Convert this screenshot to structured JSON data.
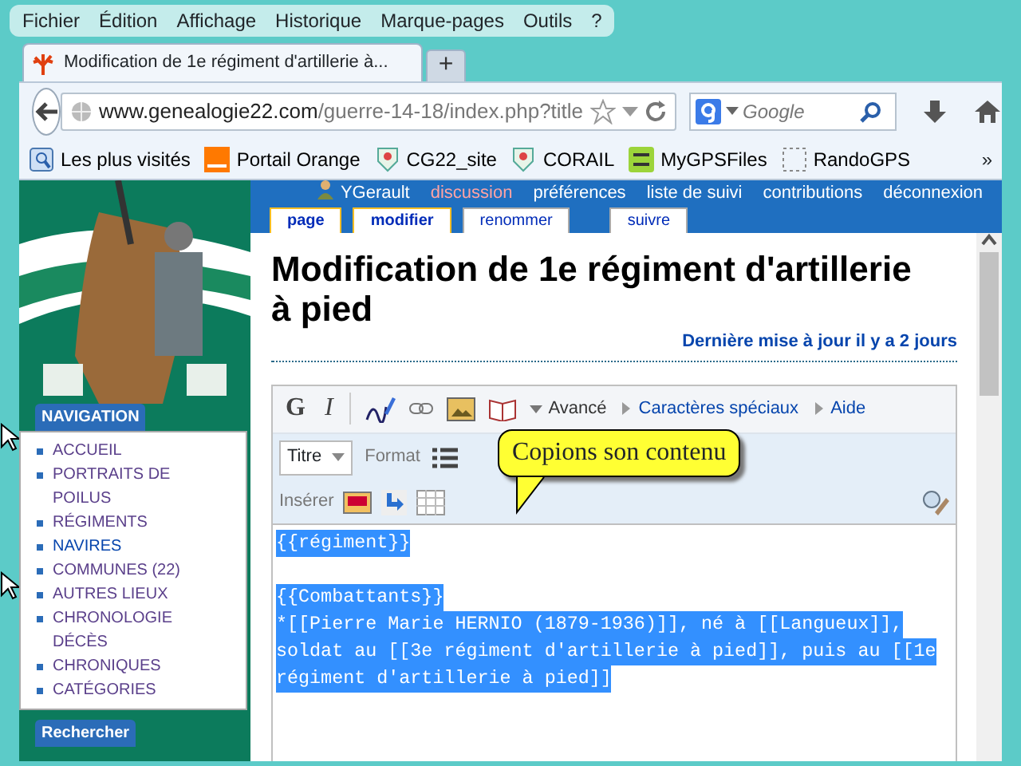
{
  "menu_bar": [
    "Fichier",
    "Édition",
    "Affichage",
    "Historique",
    "Marque-pages",
    "Outils",
    "?"
  ],
  "tabs": [
    {
      "label": "Modification de 1e régiment d'artillerie à...",
      "selected": true
    }
  ],
  "new_tab": "+",
  "address_bar": {
    "host": "www.genealogie22.com",
    "path": "/guerre-14-18/index.php?title"
  },
  "search": {
    "placeholder": "Google"
  },
  "bookmarks": [
    {
      "label": "Les plus visités",
      "kind": "history"
    },
    {
      "label": "Portail Orange",
      "kind": "orange"
    },
    {
      "label": "CG22_site",
      "kind": "crest"
    },
    {
      "label": "CORAIL",
      "kind": "crest"
    },
    {
      "label": "MyGPSFiles",
      "kind": "gps"
    },
    {
      "label": "RandoGPS",
      "kind": "blank"
    }
  ],
  "bookmarks_overflow": "»",
  "user_links": [
    {
      "label": "YGerault",
      "kind": "user"
    },
    {
      "label": "discussion",
      "kind": "missing"
    },
    {
      "label": "préférences",
      "kind": "link"
    },
    {
      "label": "liste de suivi",
      "kind": "link"
    },
    {
      "label": "contributions",
      "kind": "link"
    },
    {
      "label": "déconnexion",
      "kind": "link"
    }
  ],
  "page_tabs": [
    {
      "label": "page",
      "selected": true
    },
    {
      "label": "modifier",
      "selected": true
    },
    {
      "label": "renommer",
      "selected": false
    },
    {
      "label": "suivre",
      "selected": false
    }
  ],
  "navigation": {
    "title": "NAVIGATION",
    "items": [
      {
        "label": "ACCUEIL",
        "visited": true
      },
      {
        "label": "PORTRAITS DE POILUS",
        "visited": true
      },
      {
        "label": "RÉGIMENTS",
        "visited": true
      },
      {
        "label": "NAVIRES",
        "visited": false
      },
      {
        "label": "COMMUNES (22)",
        "visited": true
      },
      {
        "label": "AUTRES LIEUX",
        "visited": true
      },
      {
        "label": "CHRONOLOGIE DÉCÈS",
        "visited": true
      },
      {
        "label": "CHRONIQUES",
        "visited": true
      },
      {
        "label": "CATÉGORIES",
        "visited": true
      }
    ]
  },
  "search_box": {
    "title": "Rechercher"
  },
  "article": {
    "title": "Modification de 1e régiment d'artillerie à pied",
    "last_update": "Dernière mise à jour il y a 2 jours"
  },
  "editor": {
    "bold": "G",
    "italic": "I",
    "sections": [
      {
        "label": "Avancé",
        "expanded": true
      },
      {
        "label": "Caractères spéciaux",
        "expanded": false
      },
      {
        "label": "Aide",
        "expanded": false
      }
    ],
    "heading_select": "Titre",
    "format_label": "Format",
    "insert_label": "Insérer",
    "paragraphs": [
      [
        "{{régiment}}"
      ],
      [
        "{{Combattants}}",
        "*[[Pierre Marie HERNIO (1879-1936)]], né à [[Langueux]],",
        "soldat au [[3e régiment d'artillerie à pied]], puis au [[1e",
        "régiment d'artillerie à pied]]"
      ]
    ],
    "selected": true
  },
  "callout": {
    "text": "Copions son contenu"
  }
}
